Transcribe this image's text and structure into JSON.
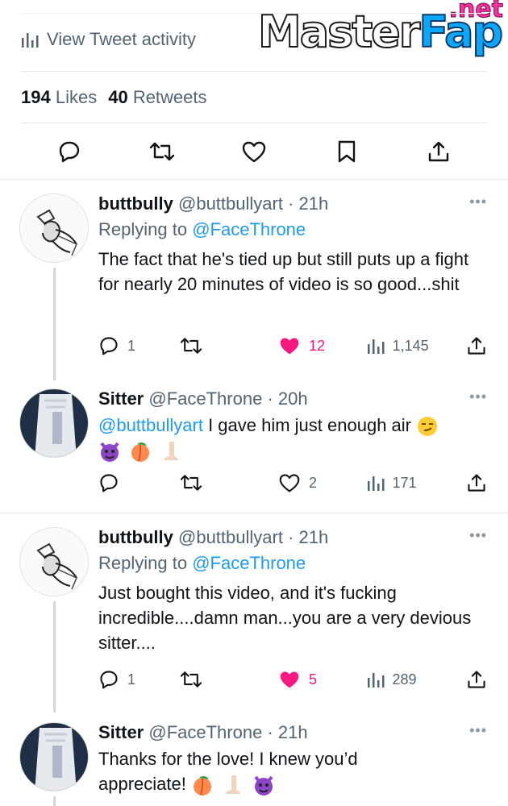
{
  "header": {
    "view_activity": "View Tweet activity",
    "likes_count": "194",
    "likes_label": "Likes",
    "retweets_count": "40",
    "retweets_label": "Retweets"
  },
  "watermark": {
    "main": "Master",
    "accent": "Fap",
    "suffix": ".net"
  },
  "tweets": [
    {
      "name": "buttbully",
      "handle": "@buttbullyart",
      "time": "· 21h",
      "replying_label": "Replying to",
      "replying_to": "@FaceThrone",
      "text": "The fact that he's tied up but still puts up a fight for nearly 20 minutes of video is so good...shit",
      "replies": "1",
      "likes": "12",
      "views": "1,145"
    },
    {
      "name": "Sitter",
      "handle": "@FaceThrone",
      "time": "· 20h",
      "mention": "@buttbullyart",
      "text": " I gave him just enough air",
      "emojis": [
        "smirk",
        "devil",
        "peach",
        "nose"
      ],
      "likes": "2",
      "views": "171"
    },
    {
      "name": "buttbully",
      "handle": "@buttbullyart",
      "time": "· 21h",
      "replying_label": "Replying to",
      "replying_to": "@FaceThrone",
      "text": "Just bought this video, and it's fucking incredible....damn man...you are a very devious sitter....",
      "replies": "1",
      "likes": "5",
      "views": "289"
    },
    {
      "name": "Sitter",
      "handle": "@FaceThrone",
      "time": "· 21h",
      "text": "Thanks for the love!  I knew you’d appreciate!",
      "emojis": [
        "peach",
        "nose",
        "devil"
      ]
    }
  ],
  "colors": {
    "link": "#1d9bf0",
    "like": "#f91880",
    "muted": "#536471"
  },
  "more_label": "•••"
}
